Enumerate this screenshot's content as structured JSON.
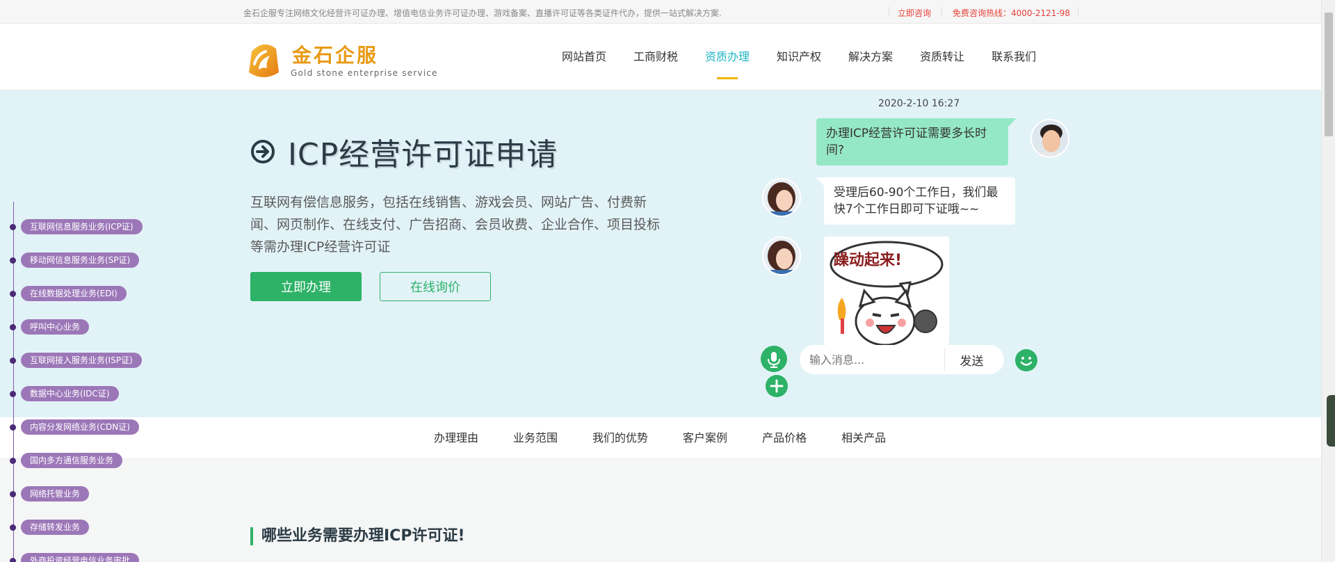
{
  "topbar": {
    "intro": "金石企服专注网络文化经营许可证办理、增值电信业务许可证办理、游戏备案、直播许可证等各类证件代办，提供一站式解决方案.",
    "consult": "立即咨询",
    "hotline": "免费咨询热线：4000-2121-98"
  },
  "logo": {
    "name_cn": "金石企服",
    "name_en": "Gold stone enterprise service"
  },
  "nav": {
    "items": [
      "网站首页",
      "工商财税",
      "资质办理",
      "知识产权",
      "解决方案",
      "资质转让",
      "联系我们"
    ],
    "active": "资质办理"
  },
  "hero": {
    "title": "ICP经营许可证申请",
    "description": "互联网有偿信息服务，包括在线销售、游戏会员、网站广告、付费新闻、网页制作、在线支付、广告招商、会员收费、企业合作、项目投标等需办理ICP经营许可证",
    "btn_apply": "立即办理",
    "btn_quote": "在线询价"
  },
  "chat": {
    "time": "2020-2-10 16:27",
    "question": "办理ICP经营许可证需要多长时间?",
    "answer": "受理后60-90个工作日，我们最快7个工作日即可下证哦~~",
    "sticker_text": "躁动起来!",
    "input_placeholder": "输入消息...",
    "send_label": "发送"
  },
  "subnav": {
    "items": [
      "办理理由",
      "业务范围",
      "我们的优势",
      "客户案例",
      "产品价格",
      "相关产品"
    ]
  },
  "section": {
    "title": "哪些业务需要办理ICP许可证!"
  },
  "sidebar": {
    "items": [
      "互联网信息服务业务(ICP证)",
      "移动网信息服务业务(SP证)",
      "在线数据处理业务(EDI)",
      "呼叫中心业务",
      "互联网接入服务业务(ISP证)",
      "数据中心业务(IDC证)",
      "内容分发网络业务(CDN证)",
      "国内多方通信服务业务",
      "网络托管业务",
      "存储转发业务",
      "外商投资经营电信业务审批"
    ]
  },
  "colors": {
    "brand_green": "#2db267",
    "nav_active": "#1fb6c5",
    "hero_bg": "#e2f3f8",
    "sidebar_pill": "#9c77b8",
    "alert_red": "#e8403a"
  }
}
